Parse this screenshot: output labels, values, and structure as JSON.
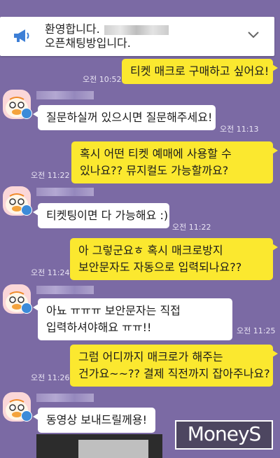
{
  "notice": {
    "line1": "환영합니다.",
    "line2": "오픈채팅방입니다.",
    "icon": "megaphone-icon",
    "expand_icon": "chevron-down-icon"
  },
  "messages": [
    {
      "id": "m1",
      "from": "me",
      "lines": [
        "티켓 매크로 구매하고 싶어요!"
      ],
      "time": "오전 10:52"
    },
    {
      "id": "m2",
      "from": "other",
      "lines": [
        "질문하실꺼 있으시면 질문해주세요!"
      ],
      "time": "오전 11:13"
    },
    {
      "id": "m3",
      "from": "me",
      "lines": [
        "혹시 어떤 티켓 예매에 사용할 수",
        "있나요?? 뮤지컬도 가능할까요?"
      ],
      "time": "오전 11:22"
    },
    {
      "id": "m4",
      "from": "other",
      "lines": [
        "티켓팅이면 다 가능해요 :)"
      ],
      "time": "오전 11:22"
    },
    {
      "id": "m5",
      "from": "me",
      "lines": [
        "아 그렇군요ㅎ 혹시 매크로방지",
        "보안문자도 자동으로 입력되나요??"
      ],
      "time": "오전 11:24"
    },
    {
      "id": "m6",
      "from": "other",
      "lines": [
        "아뇨 ㅠㅠㅠ 보안문자는 직접",
        "입력하셔야해요 ㅠㅠ!!"
      ],
      "time": "오전 11:25"
    },
    {
      "id": "m7",
      "from": "me",
      "lines": [
        "그럼 어디까지 매크로가 해주는",
        "건가요~~?? 결제 직전까지 잡아주나요?"
      ],
      "time": "오전 11:26"
    },
    {
      "id": "m8",
      "from": "other",
      "lines": [
        "동영상 보내드릴께용!"
      ],
      "time": ""
    }
  ],
  "watermark": "MoneyS",
  "colors": {
    "background": "#7b6aa4",
    "my_bubble": "#fbe82f",
    "their_bubble": "#ffffff",
    "badge": "#3c8bd9"
  }
}
